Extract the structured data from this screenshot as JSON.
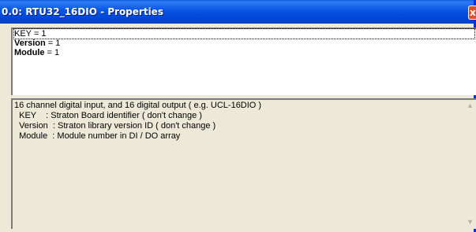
{
  "window": {
    "title": "0.0: RTU32_16DIO - Properties",
    "close_label": "x"
  },
  "properties": [
    {
      "key": "KEY",
      "value": " = 1"
    },
    {
      "key": "Version",
      "value": " = 1"
    },
    {
      "key": "Module",
      "value": " = 1"
    }
  ],
  "description": {
    "lines": [
      "16 channel digital input, and 16 digital output ( e.g. UCL-16DIO )",
      "  KEY    : Straton Board identifier ( don't change )",
      "  Version  : Straton library version ID ( don't change )",
      "  Module  : Module number in DI / DO array"
    ]
  },
  "scrollbar": {
    "up_icon": "scroll-up-arrow",
    "down_icon": "scroll-down-arrow"
  }
}
